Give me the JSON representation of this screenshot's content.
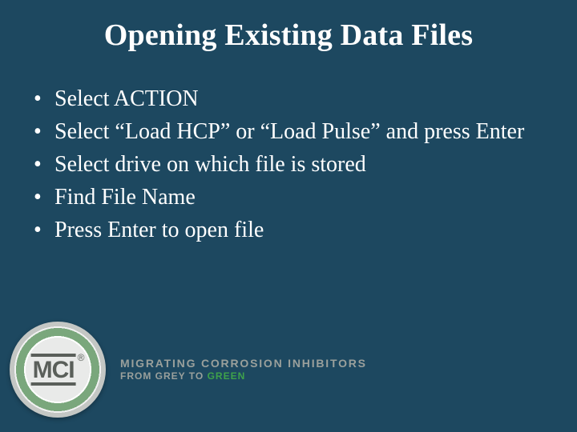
{
  "title": "Opening Existing Data Files",
  "bullets": [
    "Select ACTION",
    "Select “Load HCP” or “Load Pulse” and press Enter",
    "Select drive on which file is stored",
    "Find File Name",
    "Press Enter to open file"
  ],
  "logo": {
    "name": "MCI",
    "registered": "®",
    "tagline1": "MIGRATING CORROSION INHIBITORS",
    "tagline2a": "FROM GREY TO ",
    "tagline2b": "GREEN"
  }
}
